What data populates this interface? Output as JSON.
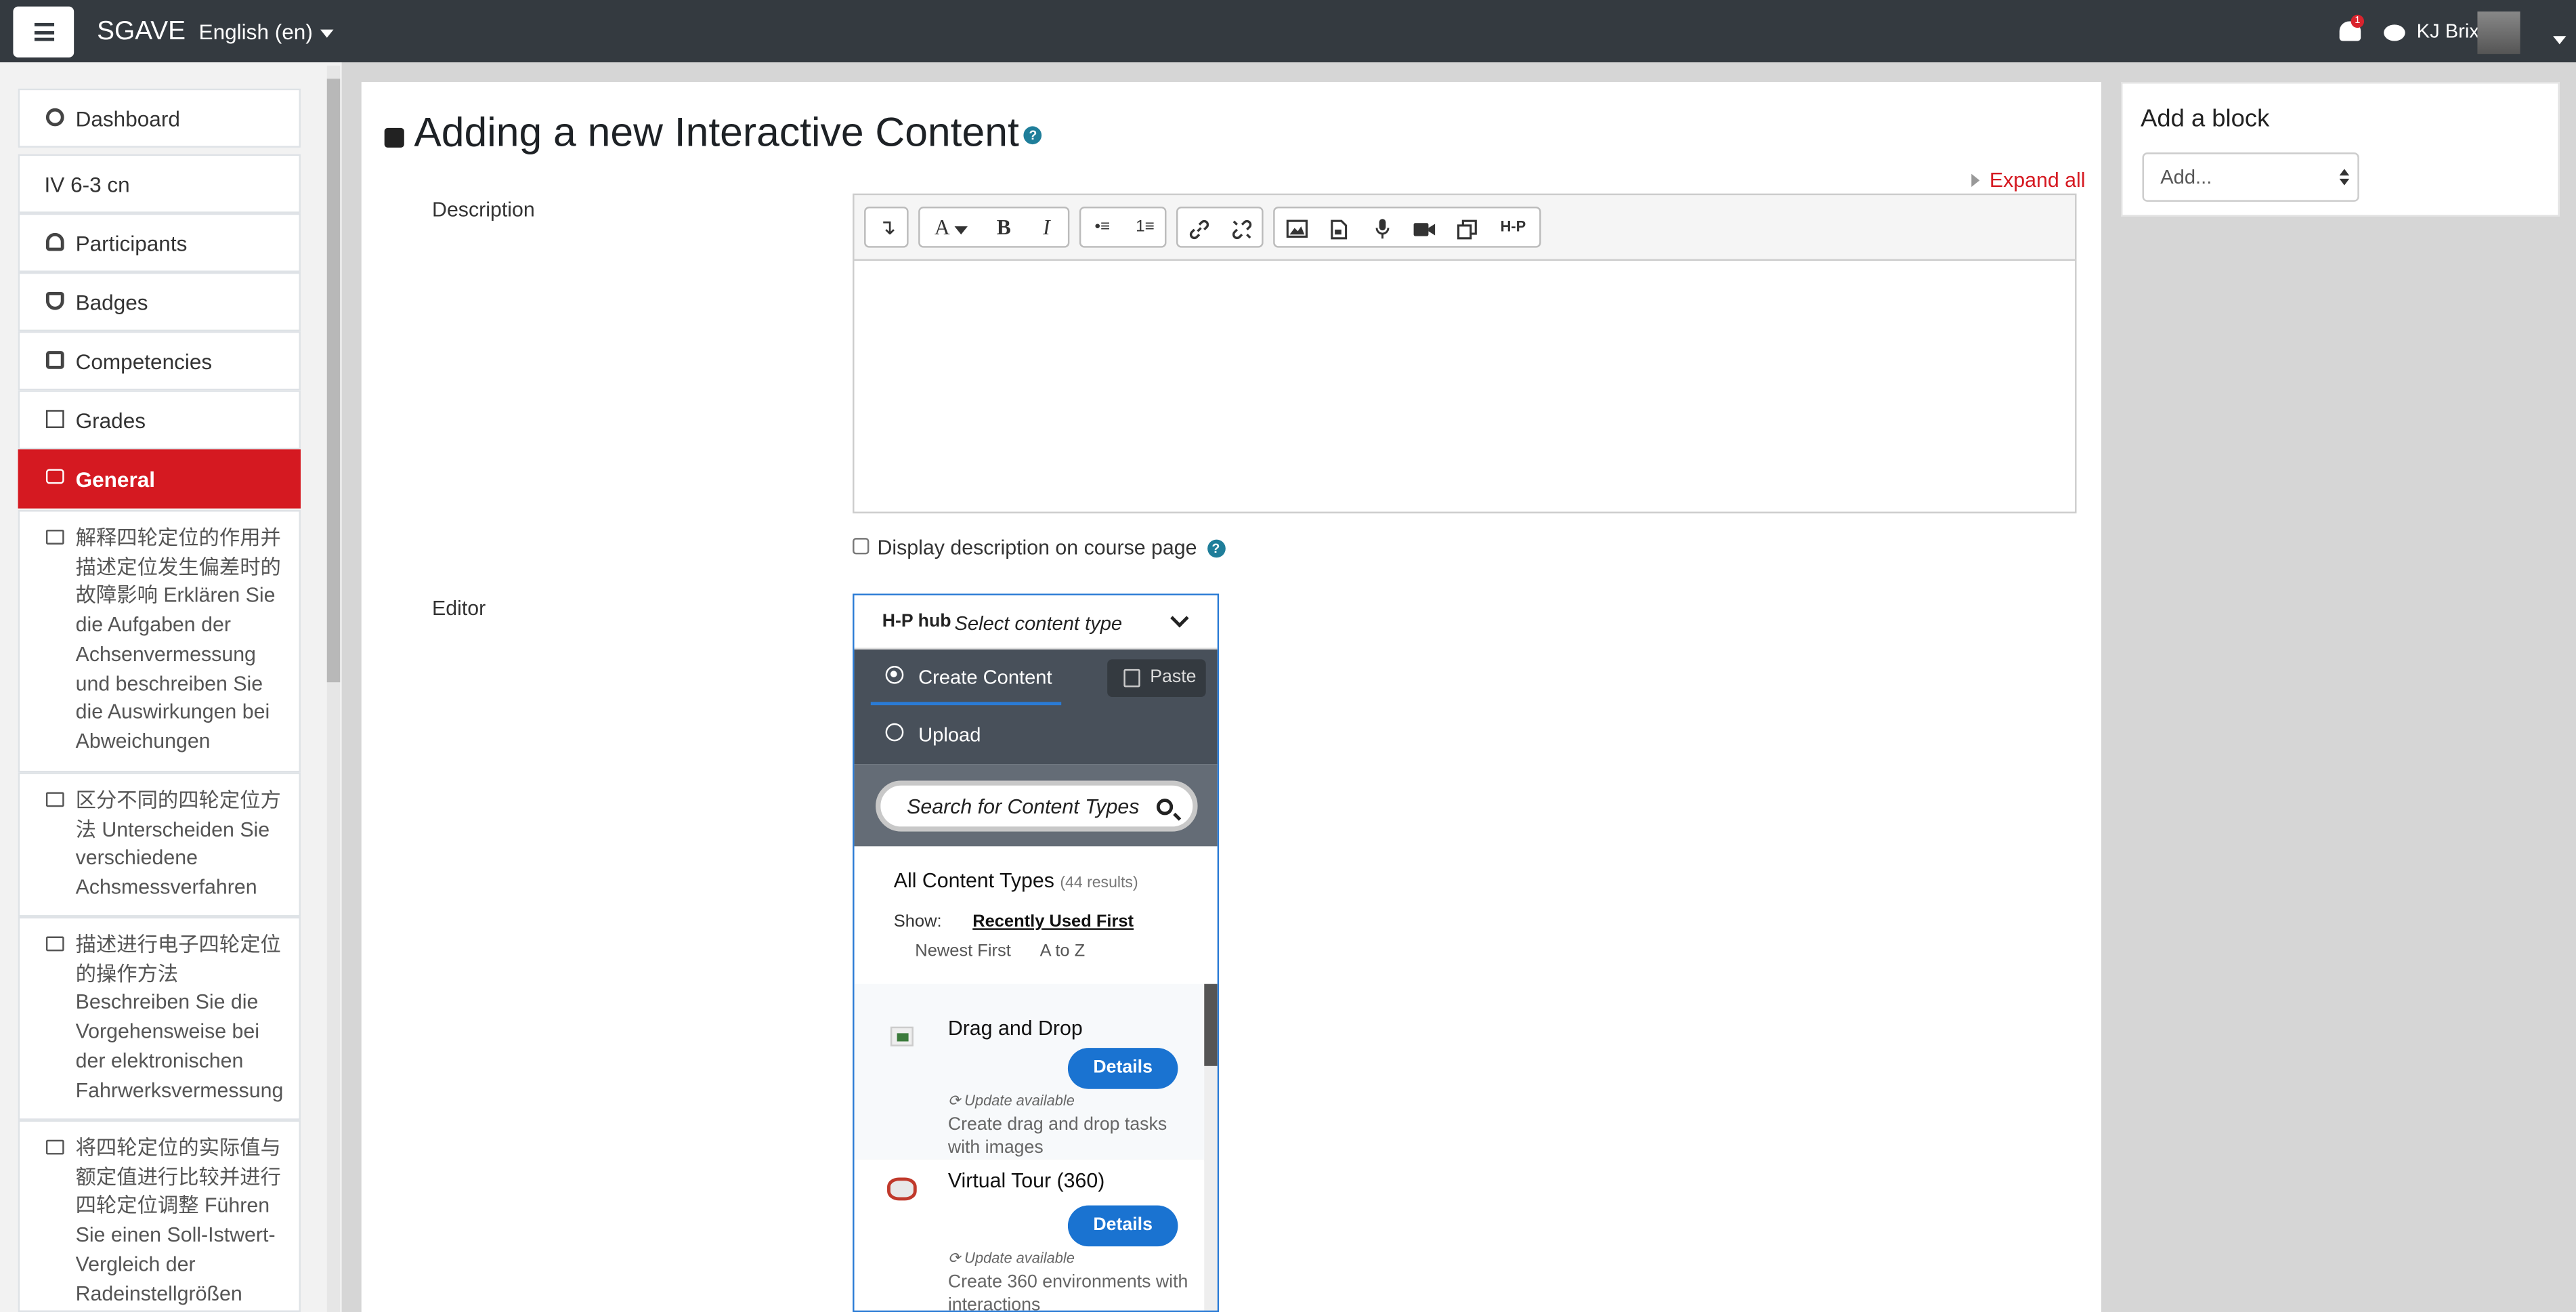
{
  "topbar": {
    "brand": "SGAVE",
    "language": "English (en)",
    "notification_count": "1",
    "user_name": "KJ Brix"
  },
  "sidebar": {
    "items": [
      {
        "label": "Dashboard",
        "icon": "dashboard-icon"
      },
      {
        "label": "IV 6-3 cn",
        "icon": ""
      },
      {
        "label": "Participants",
        "icon": "users-icon"
      },
      {
        "label": "Badges",
        "icon": "shield-icon"
      },
      {
        "label": "Competencies",
        "icon": "checkbox-icon"
      },
      {
        "label": "Grades",
        "icon": "table-icon"
      },
      {
        "label": "General",
        "icon": "folder-icon",
        "active": true
      }
    ],
    "sections": [
      {
        "label": "解释四轮定位的作用并描述定位发生偏差时的故障影响 Erklären Sie die Aufgaben der Achsenvermessung und beschreiben Sie die Auswirkungen bei Abweichungen"
      },
      {
        "label": "区分不同的四轮定位方法 Unterscheiden Sie verschiedene Achsmessverfahren"
      },
      {
        "label": "描述进行电子四轮定位的操作方法 Beschreiben Sie die Vorgehensweise bei der elektronischen Fahrwerksvermessung"
      },
      {
        "label": "将四轮定位的实际值与额定值进行比较并进行四轮定位调整 Führen Sie einen Soll-Istwert-Vergleich der Radeinstellgrößen"
      }
    ]
  },
  "main": {
    "title": "Adding a new Interactive Content",
    "expand_all": "Expand all",
    "description_label": "Description",
    "display_description_label": "Display description on course page",
    "editor_label": "Editor"
  },
  "toolbar": {
    "buttons": [
      "↴",
      "A",
      "B",
      "I",
      "•≡",
      "1≡",
      "link",
      "unlink",
      "image",
      "media",
      "mic",
      "video",
      "copy",
      "H-P"
    ]
  },
  "hub": {
    "logo": "H-P hub",
    "select_label": "Select content type",
    "create_label": "Create Content",
    "upload_label": "Upload",
    "paste_label": "Paste",
    "search_placeholder": "Search for Content Types",
    "all_types_label": "All Content Types",
    "results": "(44 results)",
    "show_label": "Show:",
    "show_options": [
      "Recently Used First",
      "Newest First",
      "A to Z"
    ],
    "items": [
      {
        "title": "Drag and Drop",
        "button": "Details",
        "update": "Update available",
        "description": "Create drag and drop tasks with images"
      },
      {
        "title": "Virtual Tour (360)",
        "button": "Details",
        "update": "Update available",
        "description": "Create 360 environments with interactions"
      }
    ]
  },
  "add_block": {
    "title": "Add a block",
    "select_value": "Add..."
  },
  "colors": {
    "topbar": "#343a40",
    "accent": "#d51921",
    "hub_blue": "#1a73d1"
  }
}
